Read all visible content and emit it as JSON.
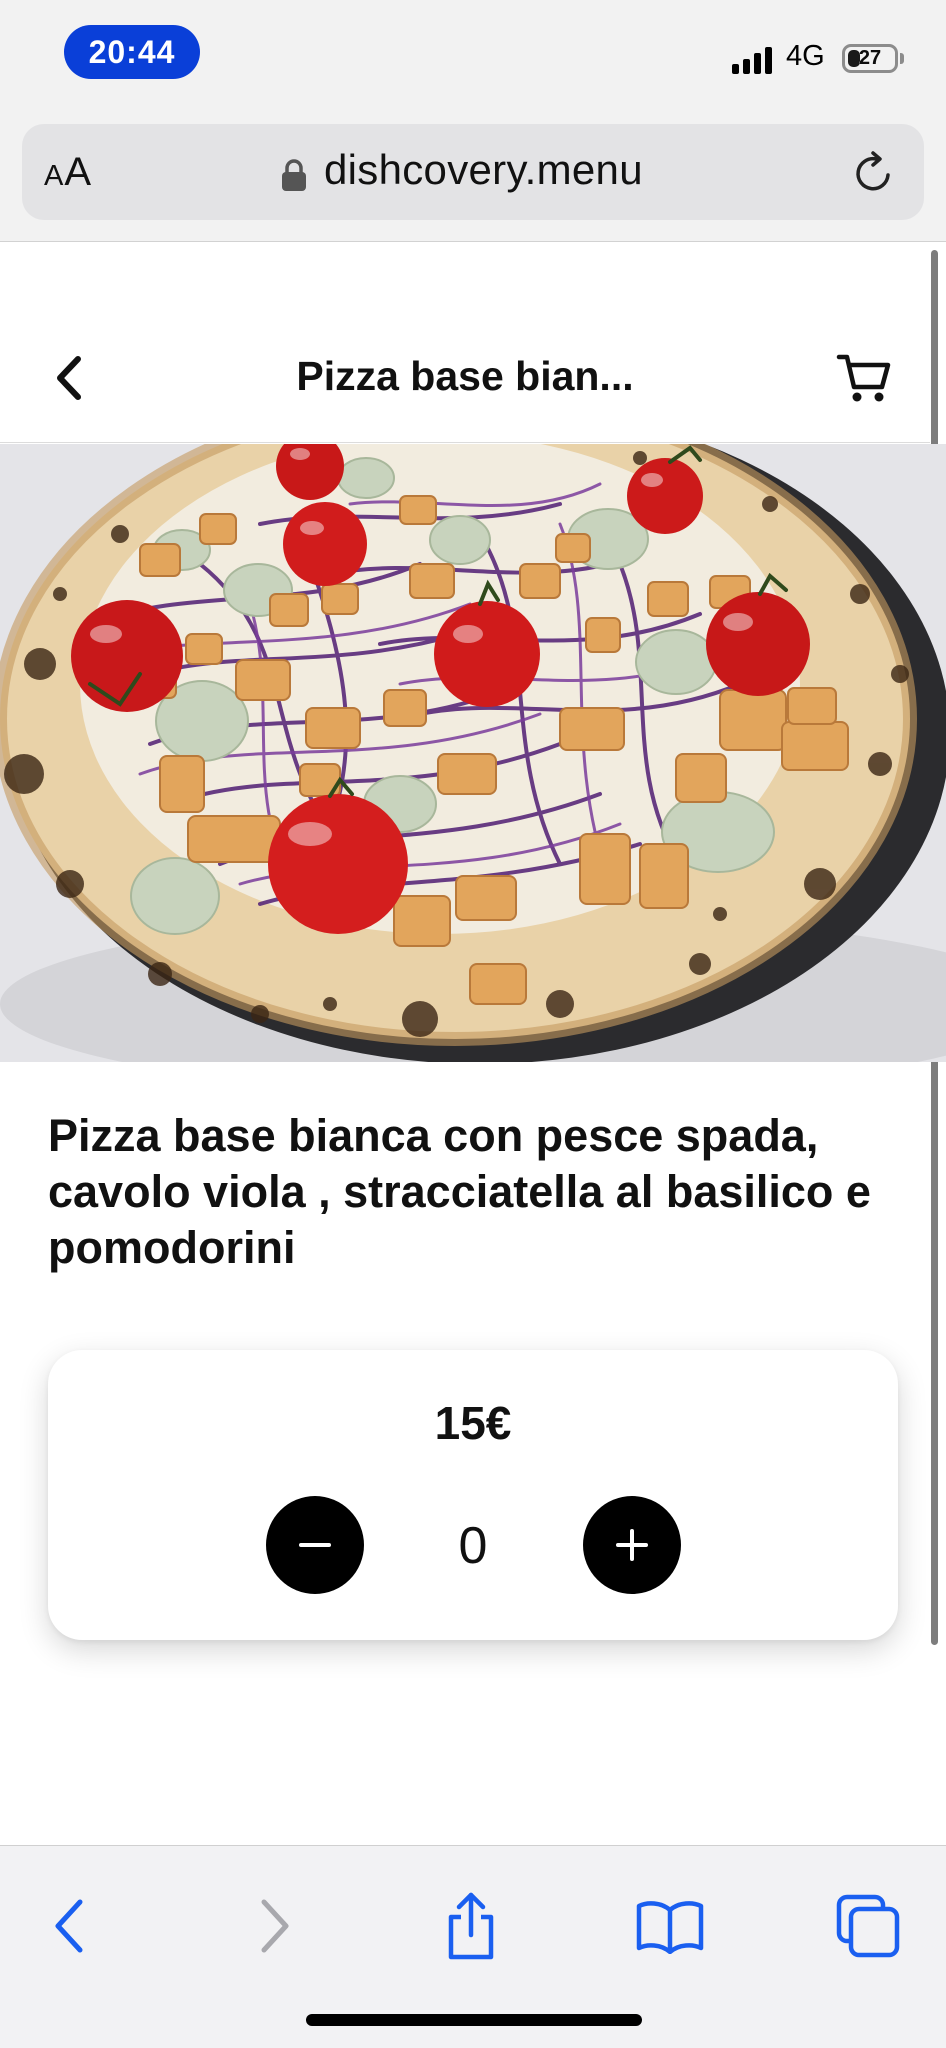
{
  "status_bar": {
    "time": "20:44",
    "network": "4G",
    "battery_level": "27",
    "battery_fraction": 0.27
  },
  "browser": {
    "text_size_label_small": "A",
    "text_size_label_large": "A",
    "url": "dishcovery.menu"
  },
  "header": {
    "title": "Pizza base bian..."
  },
  "product": {
    "name": "Pizza base bianca con pesce spada, cavolo viola , stracciatella al basilico e pomodorini",
    "image_alt": "Pizza base bianca con pesce spada, cavolo viola, stracciatella al basilico e pomodorini",
    "price": "15€",
    "quantity": "0"
  },
  "colors": {
    "time_pill": "#0a3fd8",
    "safari_blue": "#1a5ff0",
    "button_black": "#000000"
  }
}
